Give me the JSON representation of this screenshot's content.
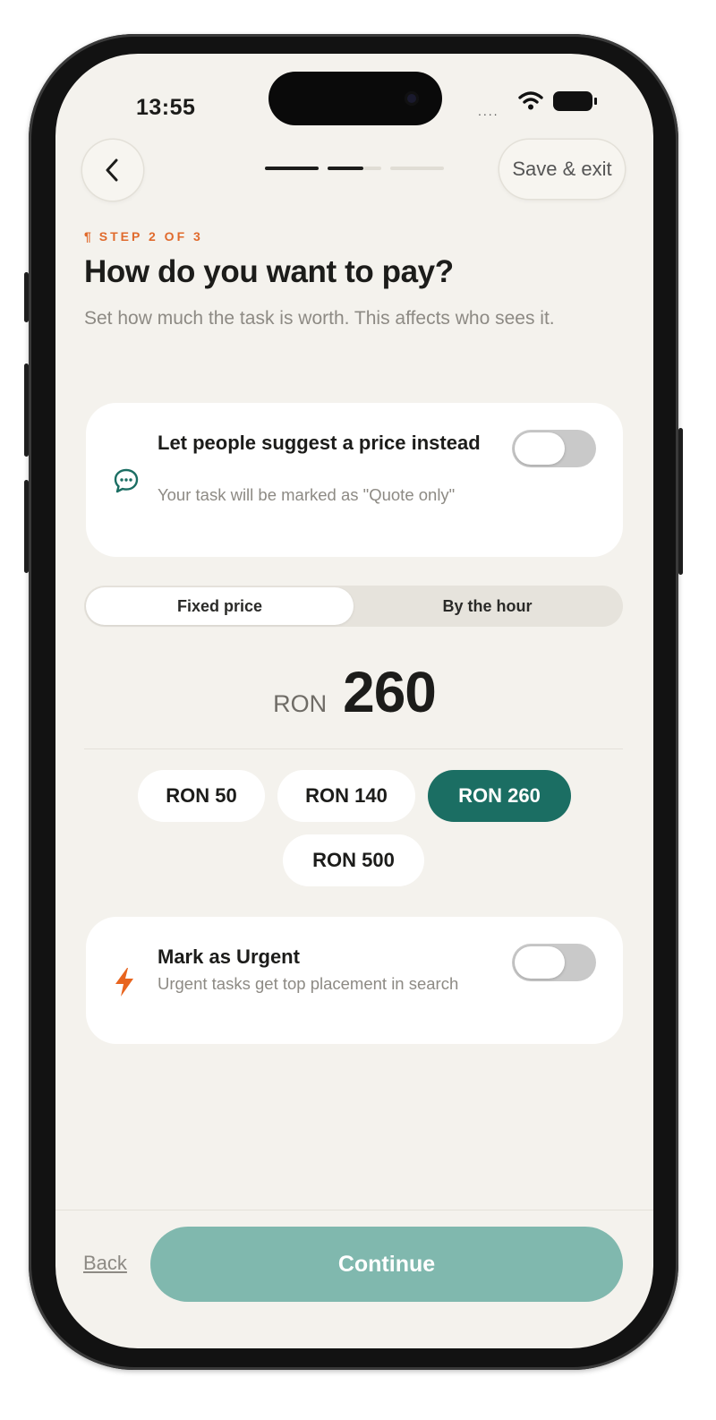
{
  "status_bar": {
    "time": "13:55",
    "signal": "....",
    "wifi_icon": "wifi-icon",
    "battery_icon": "battery-icon"
  },
  "nav": {
    "back_icon": "chevron-left-icon",
    "progress_steps": 3,
    "current_step": 2,
    "save_exit_label": "Save & exit"
  },
  "heading": {
    "step_label": "STEP 2 OF 3",
    "step_icon": "pilcrow-icon",
    "title": "How do you want to pay?",
    "subtitle": "Set how much the task is worth. This affects who sees it."
  },
  "quote_option": {
    "icon": "chat-bubble-icon",
    "title": "Let people suggest a price instead",
    "description": "Your task will be marked as \"Quote only\"",
    "enabled": false
  },
  "pricing_mode": {
    "options": [
      "Fixed price",
      "By the hour"
    ],
    "selected": "Fixed price"
  },
  "price": {
    "currency": "RON",
    "amount": "260"
  },
  "price_presets": {
    "chips": [
      "RON 50",
      "RON 140",
      "RON 260",
      "RON 500"
    ],
    "selected": "RON 260"
  },
  "urgent_option": {
    "icon": "lightning-bolt-icon",
    "title": "Mark as Urgent",
    "description": "Urgent tasks get top placement in search",
    "enabled": false
  },
  "footer": {
    "back_label": "Back",
    "continue_label": "Continue"
  },
  "colors": {
    "accent_teal": "#1b6e63",
    "continue_disabled": "#80b8ae",
    "step_orange": "#e06a2c",
    "urgent_orange": "#e8641e",
    "background": "#f4f2ed"
  }
}
